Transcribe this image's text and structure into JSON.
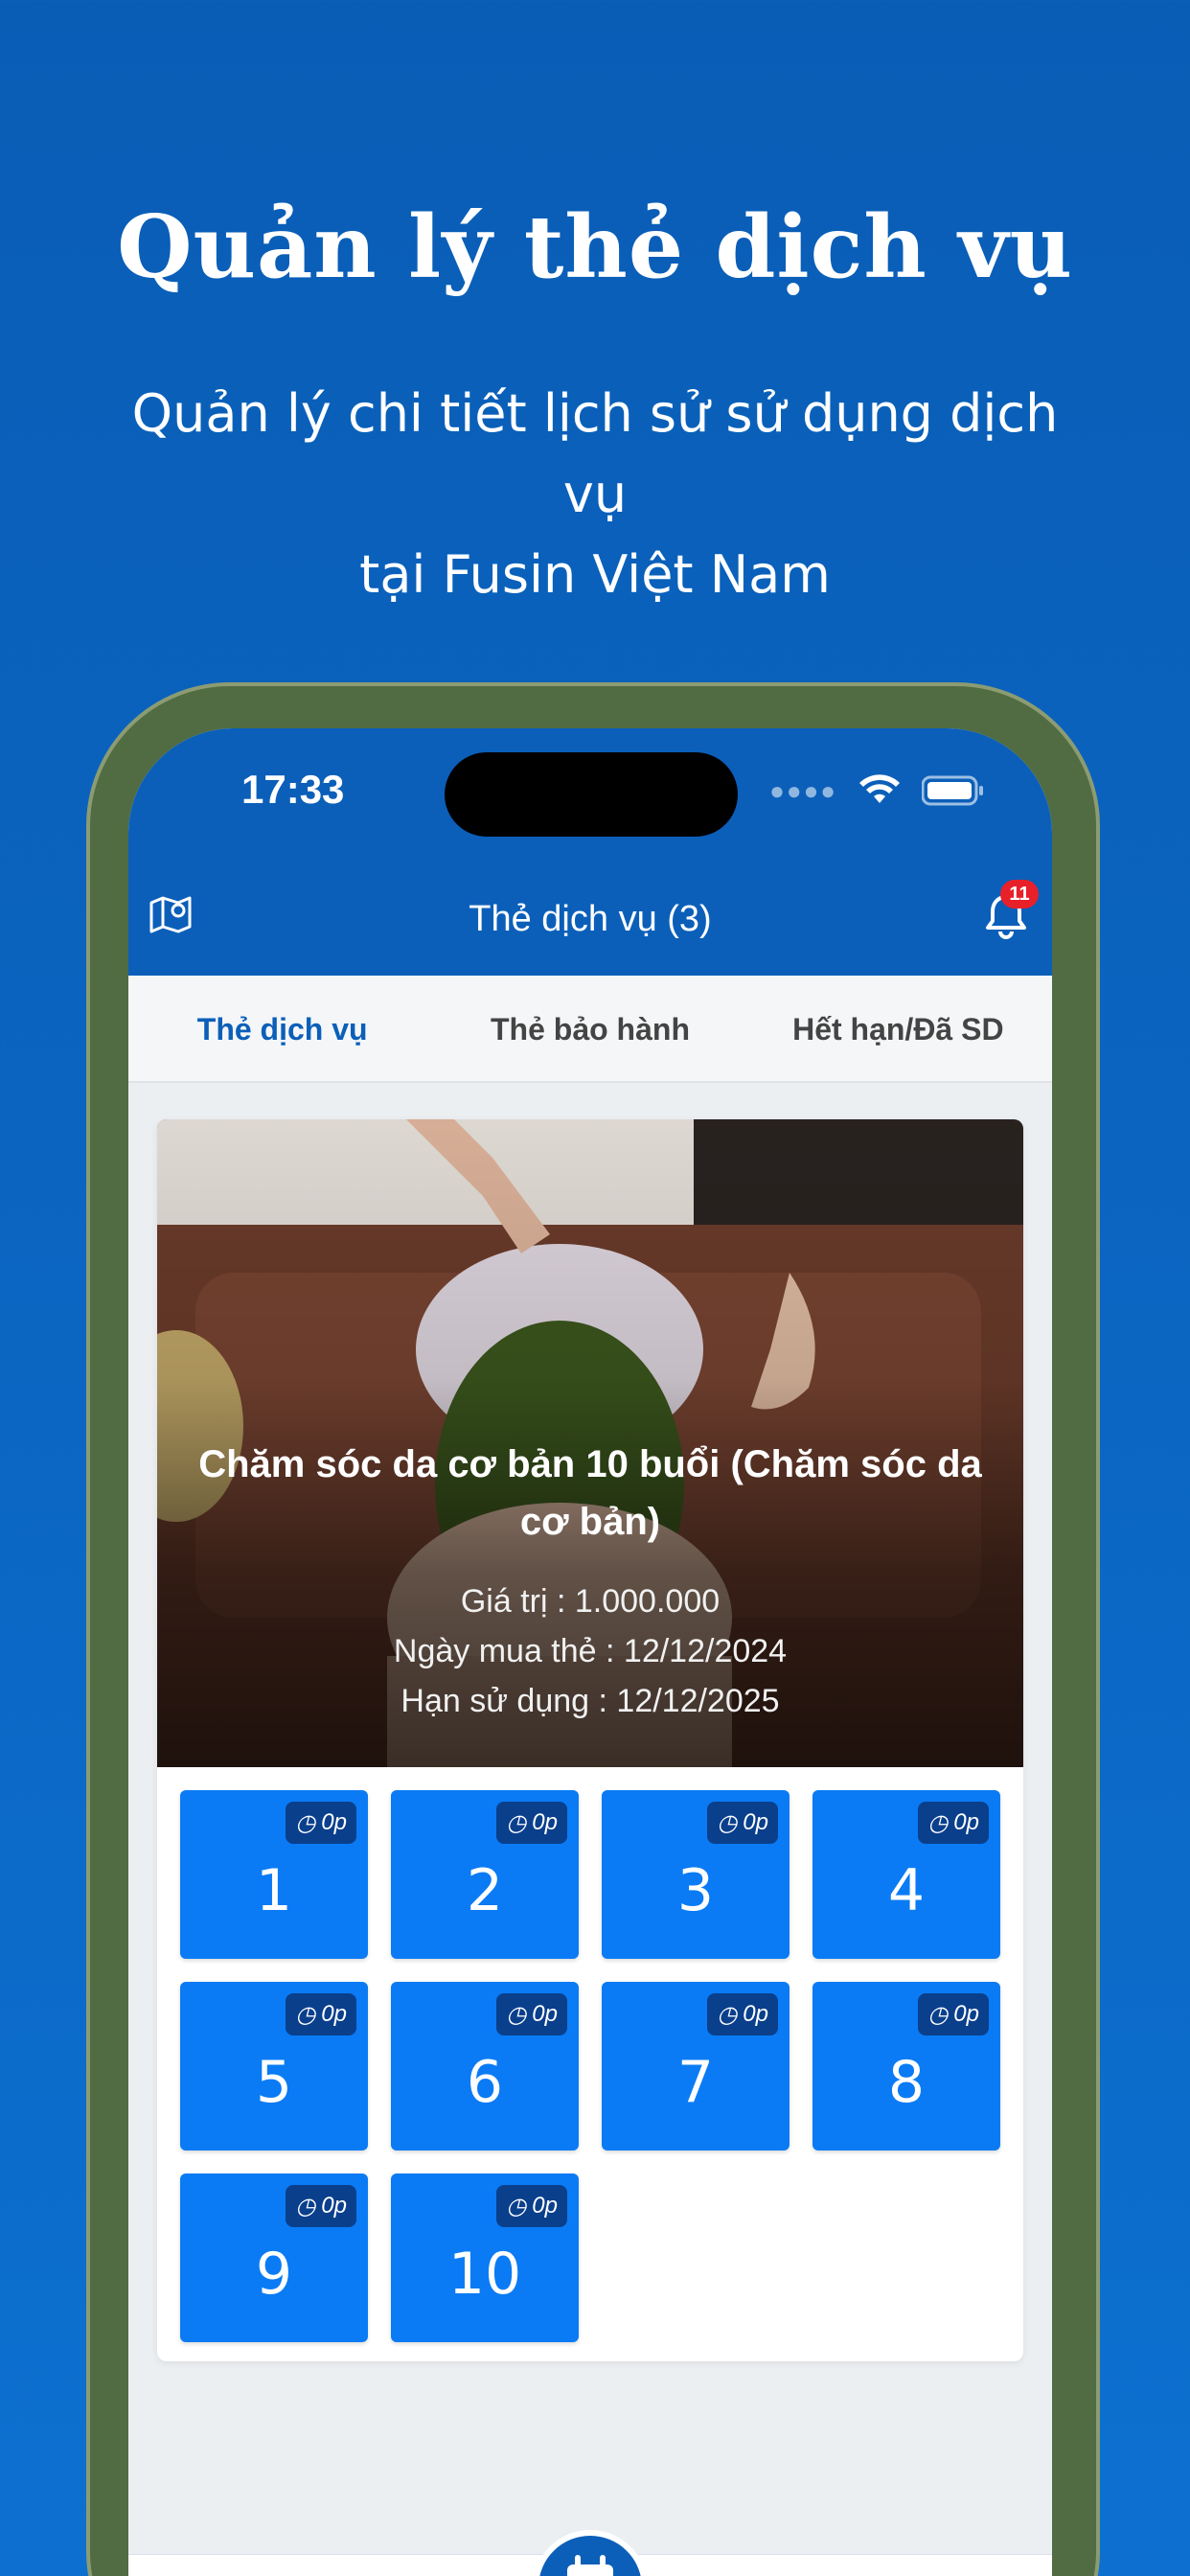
{
  "promo": {
    "title": "Quản lý thẻ dịch vụ",
    "subtitle_line1": "Quản lý chi tiết lịch sử sử dụng dịch vụ",
    "subtitle_line2": "tại Fusin Việt Nam"
  },
  "status_bar": {
    "time": "17:33"
  },
  "nav": {
    "title": "Thẻ dịch vụ (3)",
    "notification_count": "11",
    "left_icon": "map-pin-icon",
    "right_icon": "bell-icon"
  },
  "tabs": [
    {
      "label": "Thẻ dịch vụ",
      "active": true
    },
    {
      "label": "Thẻ bảo hành",
      "active": false
    },
    {
      "label": "Hết hạn/Đã SD",
      "active": false
    }
  ],
  "card": {
    "title": "Chăm sóc da cơ bản 10 buổi (Chăm sóc da cơ bản)",
    "value_line": "Giá trị : 1.000.000",
    "purchase_line": "Ngày mua thẻ : 12/12/2024",
    "expiry_line": "Hạn sử dụng : 12/12/2025",
    "sessions": [
      {
        "number": "1",
        "duration": "0p"
      },
      {
        "number": "2",
        "duration": "0p"
      },
      {
        "number": "3",
        "duration": "0p"
      },
      {
        "number": "4",
        "duration": "0p"
      },
      {
        "number": "5",
        "duration": "0p"
      },
      {
        "number": "6",
        "duration": "0p"
      },
      {
        "number": "7",
        "duration": "0p"
      },
      {
        "number": "8",
        "duration": "0p"
      },
      {
        "number": "9",
        "duration": "0p"
      },
      {
        "number": "10",
        "duration": "0p"
      }
    ]
  },
  "colors": {
    "brand_blue": "#0b5fb9",
    "session_blue": "#0a7bf5",
    "badge_red": "#e8202a",
    "phone_frame": "#516c43"
  }
}
